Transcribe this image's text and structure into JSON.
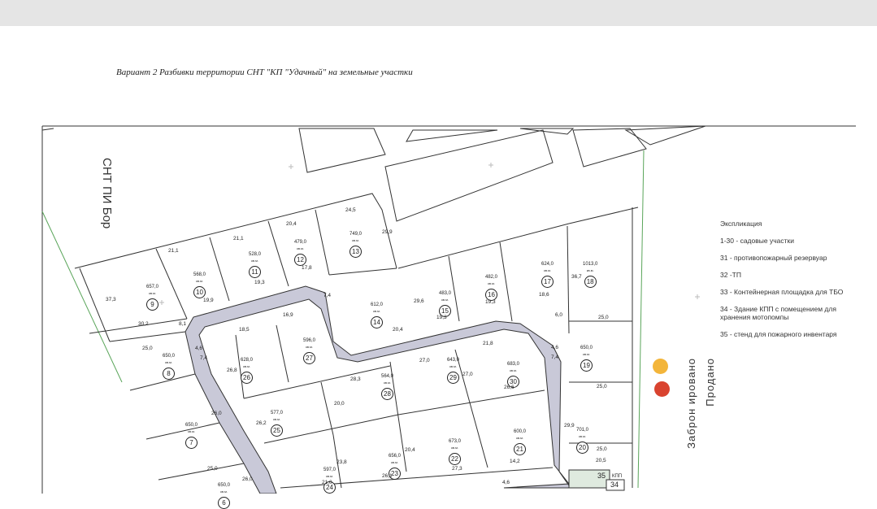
{
  "document": {
    "title": "Вариант 2 Разбивки территории СНТ \"КП \"Удачный\" на земельные участки"
  },
  "neighbor_label": "СНТ ПИ Бор",
  "legend": {
    "title": "Экспликация",
    "items": [
      "1-30 - садовые участки",
      "31 - противопожарный резервуар",
      "32 -ТП",
      "33 - Контейнерная площадка для ТБО",
      "34 - Здание КПП с помещением для хранения мотопомпы",
      "35 - стенд для пожарного инвентаря"
    ]
  },
  "markers": {
    "yellow_label": "Заброн ировано",
    "red_label": "Продано",
    "yellow_color": "#f3b53a",
    "red_color": "#d9432f"
  },
  "plots": [
    {
      "num": "9",
      "area": "657,0"
    },
    {
      "num": "10",
      "area": "568,0"
    },
    {
      "num": "11",
      "area": "528,0"
    },
    {
      "num": "12",
      "area": "479,0"
    },
    {
      "num": "13",
      "area": "749,0"
    },
    {
      "num": "14",
      "area": "612,0"
    },
    {
      "num": "15",
      "area": "483,0"
    },
    {
      "num": "16",
      "area": "482,0"
    },
    {
      "num": "17",
      "area": "624,0"
    },
    {
      "num": "18",
      "area": "1013,0"
    },
    {
      "num": "8",
      "area": "650,0"
    },
    {
      "num": "26",
      "area": "628,0"
    },
    {
      "num": "27",
      "area": "596,0"
    },
    {
      "num": "28",
      "area": "564,0"
    },
    {
      "num": "29",
      "area": "643,0"
    },
    {
      "num": "30",
      "area": "683,0"
    },
    {
      "num": "19",
      "area": "650,0"
    },
    {
      "num": "7",
      "area": "650,0"
    },
    {
      "num": "25",
      "area": "577,0"
    },
    {
      "num": "22",
      "area": "673,0"
    },
    {
      "num": "21",
      "area": "600,0"
    },
    {
      "num": "20",
      "area": "701,0"
    },
    {
      "num": "23",
      "area": "656,0"
    },
    {
      "num": "24",
      "area": "597,0"
    },
    {
      "num": "6",
      "area": "650,0"
    }
  ],
  "unit": "кв.м.",
  "dimensions": [
    "21,1",
    "21,1",
    "20,4",
    "24,5",
    "29,9",
    "37,3",
    "30,2",
    "19,9",
    "19,3",
    "17,8",
    "7,4",
    "20,4",
    "29,6",
    "19,3",
    "19,3",
    "18,6",
    "36,7",
    "6,0",
    "25,0",
    "25,0",
    "8,1",
    "18,5",
    "16,9",
    "4,6",
    "7,4",
    "26,8",
    "27,0",
    "21,8",
    "4,6",
    "7,4",
    "28,3",
    "20,0",
    "26,2",
    "26,6",
    "25,0",
    "26,0",
    "20,4",
    "27,0",
    "29,9",
    "25,0",
    "20,5",
    "21,0",
    "26,1",
    "27,3",
    "14,2",
    "23,8",
    "4,6",
    "26,0",
    "25,0"
  ],
  "kpp": {
    "num35": "35",
    "num34": "34",
    "label": "КПП"
  }
}
